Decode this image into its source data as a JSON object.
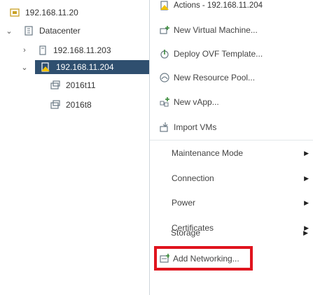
{
  "tree": {
    "root": {
      "label": "192.168.11.20"
    },
    "datacenter": {
      "label": "Datacenter"
    },
    "host1": {
      "label": "192.168.11.203"
    },
    "host2": {
      "label": "192.168.11.204"
    },
    "vm1": {
      "label": "2016t11"
    },
    "vm2": {
      "label": "2016t8"
    }
  },
  "menu": {
    "header": "Actions - 192.168.11.204",
    "items": [
      {
        "label": "New Virtual Machine...",
        "icon": "new-vm-icon"
      },
      {
        "label": "Deploy OVF Template...",
        "icon": "deploy-ovf-icon"
      },
      {
        "label": "New Resource Pool...",
        "icon": "resource-pool-icon"
      },
      {
        "label": "New vApp...",
        "icon": "new-vapp-icon"
      },
      {
        "label": "Import VMs",
        "icon": "import-vms-icon"
      }
    ],
    "submenus": [
      {
        "label": "Maintenance Mode"
      },
      {
        "label": "Connection"
      },
      {
        "label": "Power"
      },
      {
        "label": "Certificates"
      },
      {
        "label": "Storage"
      }
    ],
    "add_networking": {
      "label": "Add Networking..."
    }
  },
  "colors": {
    "selection_bg": "#2f4f6f",
    "highlight_border": "#e0141e",
    "icon": "#6b7a86"
  }
}
